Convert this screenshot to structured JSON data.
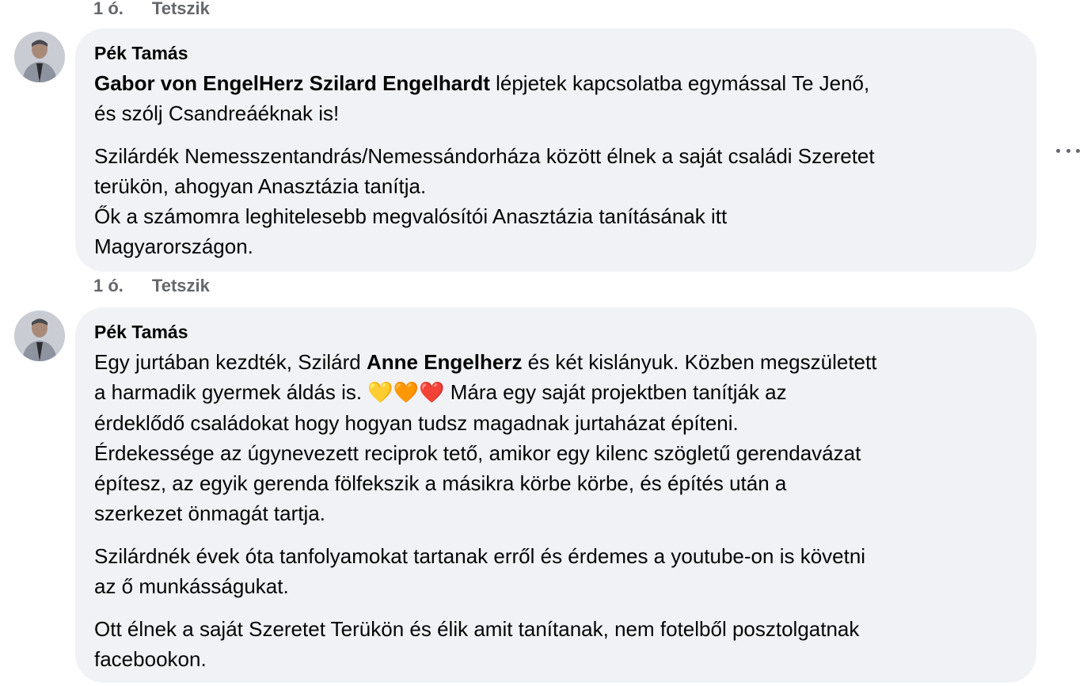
{
  "top_meta": {
    "time": "1 ó.",
    "like": "Tetszik"
  },
  "comments": [
    {
      "author": "Pék Tamás",
      "p1_mention": "Gabor von EngelHerz Szilard Engelhardt",
      "p1_text_a": " lépjetek kapcsolatba egymással Te Jenő,",
      "p1_text_b": "és szólj Csandreáéknak is!",
      "p2_l1": "Szilárdék Nemesszentandrás/Nemessándorháza között élnek a saját családi Szeretet",
      "p2_l2": "terükön, ahogyan Anasztázia tanítja.",
      "p2_l3": "Ők a számomra leghitelesebb megvalósítói Anasztázia tanításának itt",
      "p2_l4": "Magyarországon.",
      "time": "1 ó.",
      "like": "Tetszik",
      "more_icon": "more-horizontal-icon"
    },
    {
      "author": "Pék Tamás",
      "p1_l1_a": "Egy jurtában kezdték, Szilárd ",
      "p1_mention": "Anne Engelherz",
      "p1_l1_b": " és két kislányuk. Közben megszületett",
      "p1_l2_a": "a harmadik gyermek áldás is. ",
      "emoji": "💛🧡❤️",
      "p1_l2_b": " Mára egy saját projektben tanítják az",
      "p1_l3": "érdeklődő családokat hogy hogyan tudsz magadnak jurtaházat építeni.",
      "p1_l4": "Érdekessége az úgynevezett reciprok tető, amikor egy kilenc szögletű gerendavázat",
      "p1_l5": "építesz, az egyik gerenda fölfekszik a másikra körbe körbe, és építés után a",
      "p1_l6": "szerkezet önmagát tartja.",
      "p2_l1": "Szilárdnék évek óta tanfolyamokat tartanak erről és érdemes a youtube-on is követni",
      "p2_l2": "az ő munkásságukat.",
      "p3_l1": "Ott élnek a saját Szeretet Terükön és élik amit tanítanak, nem fotelből posztolgatnak",
      "p3_l2": "facebookon."
    }
  ]
}
